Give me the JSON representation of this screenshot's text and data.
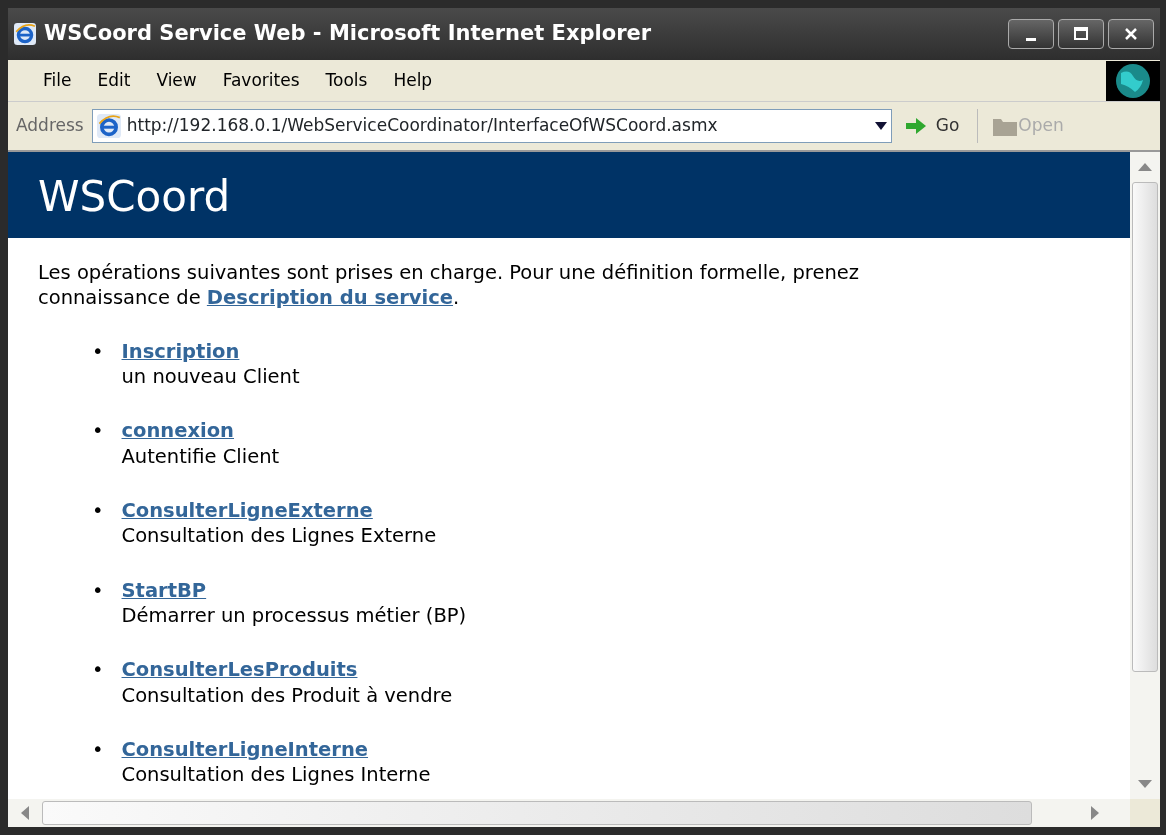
{
  "window": {
    "title": "WSCoord Service Web - Microsoft Internet Explorer"
  },
  "menu": [
    "File",
    "Edit",
    "View",
    "Favorites",
    "Tools",
    "Help"
  ],
  "address_bar": {
    "label": "Address",
    "value": "http://192.168.0.1/WebServiceCoordinator/InterfaceOfWSCoord.asmx",
    "go": "Go",
    "open": "Open"
  },
  "page": {
    "heading": "WSCoord",
    "intro": "Les opérations suivantes sont prises en charge. Pour une définition formelle, prenez connaissance de ",
    "intro_link": "Description du service",
    "intro_end": ".",
    "bullet": "•",
    "operations": [
      {
        "name": "Inscription",
        "description": "un nouveau Client"
      },
      {
        "name": "connexion",
        "description": "Autentifie Client"
      },
      {
        "name": "ConsulterLigneExterne",
        "description": "Consultation des Lignes Externe"
      },
      {
        "name": "StartBP",
        "description": "Démarrer un processus métier (BP)"
      },
      {
        "name": "ConsulterLesProduits",
        "description": "Consultation des Produit à vendre"
      },
      {
        "name": "ConsulterLigneInterne",
        "description": "Consultation des Lignes Interne"
      }
    ]
  }
}
